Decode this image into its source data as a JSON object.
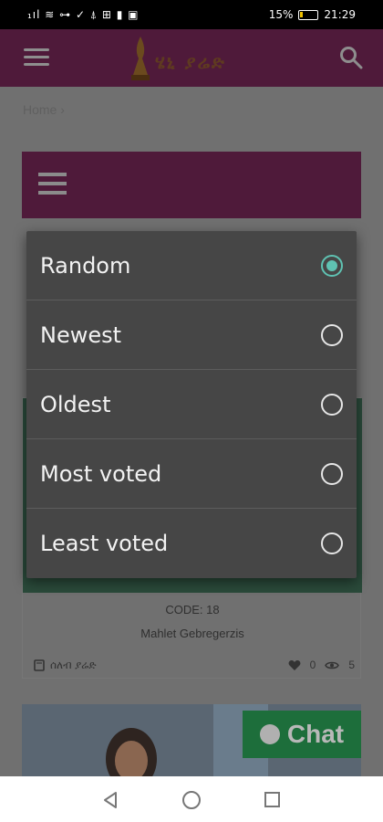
{
  "status": {
    "left_icons": "₁ıl ≋ ⊶ ✓ ⍋ ⊞ ▮ ▣",
    "battery": "15%",
    "time": "21:29"
  },
  "header": {
    "logo_text": "ሄኒ ያሬድ",
    "menu_icon": "hamburger-icon",
    "search_icon": "search-icon"
  },
  "breadcrumb": {
    "home": "Home",
    "sep": "›"
  },
  "sort_options": [
    {
      "label": "Random",
      "selected": true
    },
    {
      "label": "Newest",
      "selected": false
    },
    {
      "label": "Oldest",
      "selected": false
    },
    {
      "label": "Most voted",
      "selected": false
    },
    {
      "label": "Least voted",
      "selected": false
    }
  ],
  "card": {
    "code": "CODE: 18",
    "name": "Mahlet Gebregerzis",
    "author": "ሰለብ ያሬድ",
    "likes": "0",
    "views": "5"
  },
  "chat": {
    "label": "Chat"
  },
  "colors": {
    "brand": "#7a1a5a",
    "radio_active": "#5fc2b2"
  }
}
